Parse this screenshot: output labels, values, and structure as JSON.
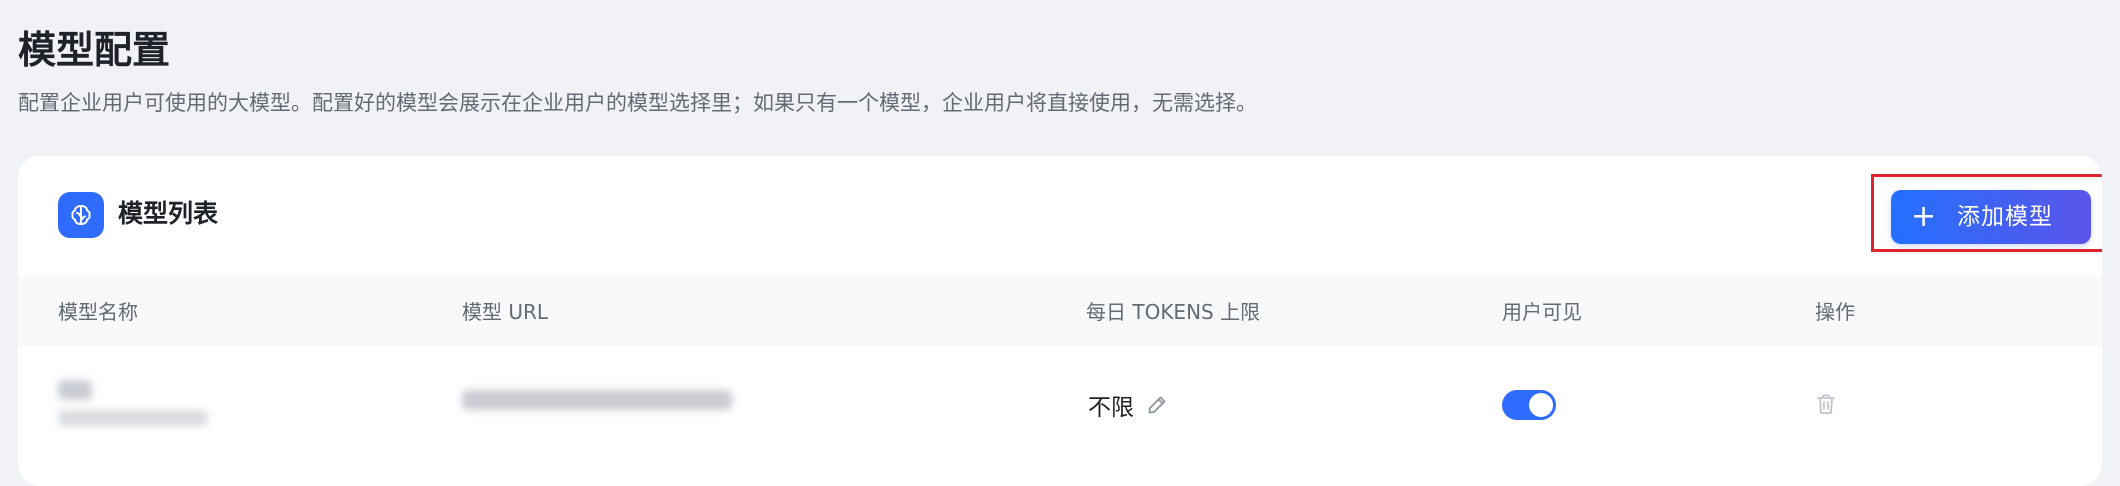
{
  "page": {
    "title": "模型配置",
    "description": "配置企业用户可使用的大模型。配置好的模型会展示在企业用户的模型选择里；如果只有一个模型，企业用户将直接使用，无需选择。"
  },
  "card": {
    "title": "模型列表",
    "icon": "brain-icon",
    "add_button": {
      "label": "添加模型",
      "icon": "plus-icon"
    }
  },
  "table": {
    "columns": [
      "模型名称",
      "模型 URL",
      "每日 TOKENS 上限",
      "用户可见",
      "操作"
    ],
    "rows": [
      {
        "tokens_limit": "不限",
        "user_visible": true
      }
    ]
  },
  "colors": {
    "accent": "#2f6bff",
    "button_gradient_start": "#2470ff",
    "button_gradient_end": "#5a55e8",
    "highlight_border": "#e0232e",
    "page_bg": "#f1f2f6"
  }
}
